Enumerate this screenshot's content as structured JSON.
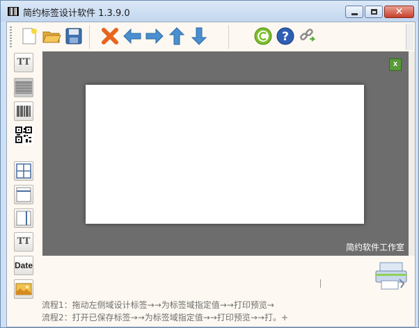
{
  "window": {
    "title": "简约标签设计软件  1.3.9.0"
  },
  "toolbar": {
    "icons": [
      "new-file-icon",
      "open-folder-icon",
      "save-icon",
      "delete-icon",
      "arrow-left-icon",
      "arrow-right-icon",
      "arrow-up-icon",
      "arrow-down-icon",
      "copyright-icon",
      "help-icon",
      "link-icon"
    ]
  },
  "sidebar": {
    "text_label": "TT",
    "multiline_label": "TT",
    "date_label": "Date"
  },
  "canvas": {
    "studio_name": "简约软件工作室",
    "background": "#6d6d6d"
  },
  "flow": {
    "line1": "流程1：拖动左侧域设计标签→→为标签域指定值→→打印预览→",
    "line2": "流程2：打开已保存标签→→为标签域指定值→→打印预览→→打。+"
  },
  "colors": {
    "accent_blue": "#4a8fcf",
    "delete_orange": "#e8641e",
    "copyright_green": "#7cbf2a",
    "help_blue": "#2f5fb5"
  }
}
